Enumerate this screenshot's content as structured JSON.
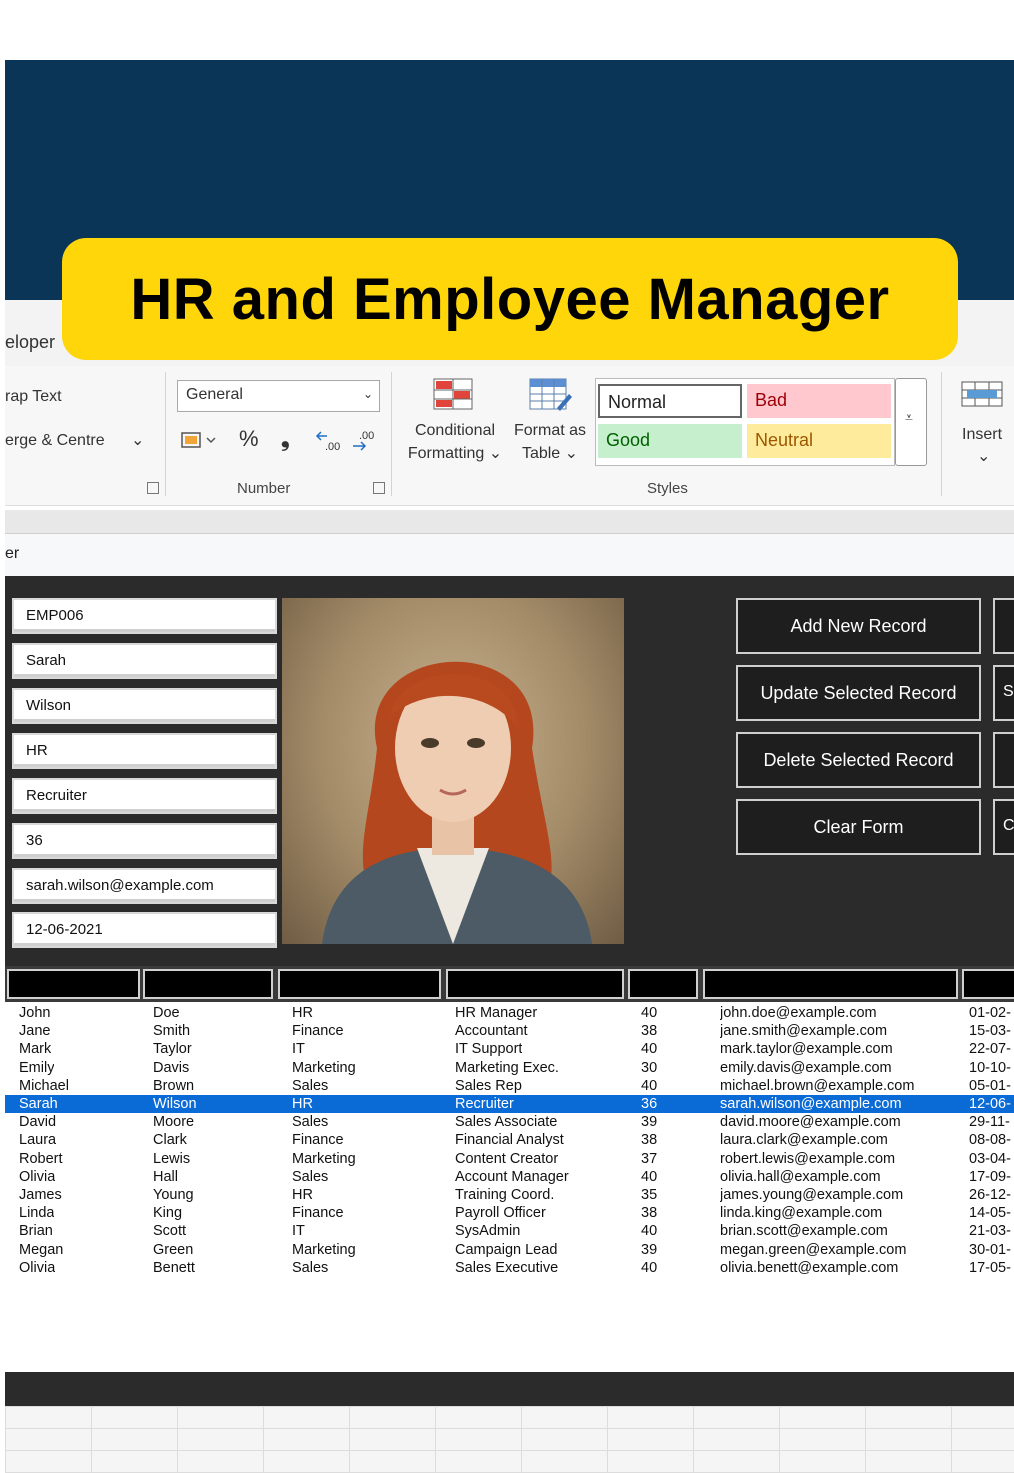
{
  "title": "HR and Employee Manager",
  "colors": {
    "banner": "#0a3556",
    "title_bg": "#ffd60a",
    "selection": "#0a6ad6",
    "form_bg": "#2b2b2b"
  },
  "tabs": {
    "developer": "eloper"
  },
  "ribbon": {
    "wrap_text": "rap Text",
    "merge_centre": "erge & Centre",
    "merge_arrow": "⌄",
    "number_format": "General",
    "number_group": "Number",
    "percent": "%",
    "comma": "❟",
    "conditional_formatting": [
      "Conditional",
      "Formatting ⌄"
    ],
    "format_as_table": [
      "Format as",
      "Table ⌄"
    ],
    "styles": {
      "normal": "Normal",
      "bad": "Bad",
      "good": "Good",
      "neutral": "Neutral"
    },
    "styles_group": "Styles",
    "insert": "Insert",
    "insert_arrow": "⌄"
  },
  "form_title": "er",
  "form": {
    "fields": [
      "EMP006",
      "Sarah",
      "Wilson",
      "HR",
      "Recruiter",
      "36",
      "sarah.wilson@example.com",
      "12-06-2021"
    ],
    "buttons": [
      "Add New Record",
      "Update Selected Record",
      "Delete Selected Record",
      "Clear Form"
    ],
    "side_stubs": [
      "",
      "S",
      "",
      "C"
    ]
  },
  "employees": [
    [
      "John",
      "Doe",
      "HR",
      "HR Manager",
      "40",
      "john.doe@example.com",
      "01-02-"
    ],
    [
      "Jane",
      "Smith",
      "Finance",
      "Accountant",
      "38",
      "jane.smith@example.com",
      "15-03-"
    ],
    [
      "Mark",
      "Taylor",
      "IT",
      "IT Support",
      "40",
      "mark.taylor@example.com",
      "22-07-"
    ],
    [
      "Emily",
      "Davis",
      "Marketing",
      "Marketing Exec.",
      "30",
      "emily.davis@example.com",
      "10-10-"
    ],
    [
      "Michael",
      "Brown",
      "Sales",
      "Sales Rep",
      "40",
      "michael.brown@example.com",
      "05-01-"
    ],
    [
      "Sarah",
      "Wilson",
      "HR",
      "Recruiter",
      "36",
      "sarah.wilson@example.com",
      "12-06-"
    ],
    [
      "David",
      "Moore",
      "Sales",
      "Sales Associate",
      "39",
      "david.moore@example.com",
      "29-11-"
    ],
    [
      "Laura",
      "Clark",
      "Finance",
      "Financial Analyst",
      "38",
      "laura.clark@example.com",
      "08-08-"
    ],
    [
      "Robert",
      "Lewis",
      "Marketing",
      "Content Creator",
      "37",
      "robert.lewis@example.com",
      "03-04-"
    ],
    [
      "Olivia",
      "Hall",
      "Sales",
      "Account Manager",
      "40",
      "olivia.hall@example.com",
      "17-09-"
    ],
    [
      "James",
      "Young",
      "HR",
      "Training Coord.",
      "35",
      "james.young@example.com",
      "26-12-"
    ],
    [
      "Linda",
      "King",
      "Finance",
      "Payroll Officer",
      "38",
      "linda.king@example.com",
      "14-05-"
    ],
    [
      "Brian",
      "Scott",
      "IT",
      "SysAdmin",
      "40",
      "brian.scott@example.com",
      "21-03-"
    ],
    [
      "Megan",
      "Green",
      "Marketing",
      "Campaign Lead",
      "39",
      "megan.green@example.com",
      "30-01-"
    ],
    [
      "Olivia",
      "Benett",
      "Sales",
      "Sales Executive",
      "40",
      "olivia.benett@example.com",
      "17-05-"
    ]
  ],
  "selected_row": 5
}
